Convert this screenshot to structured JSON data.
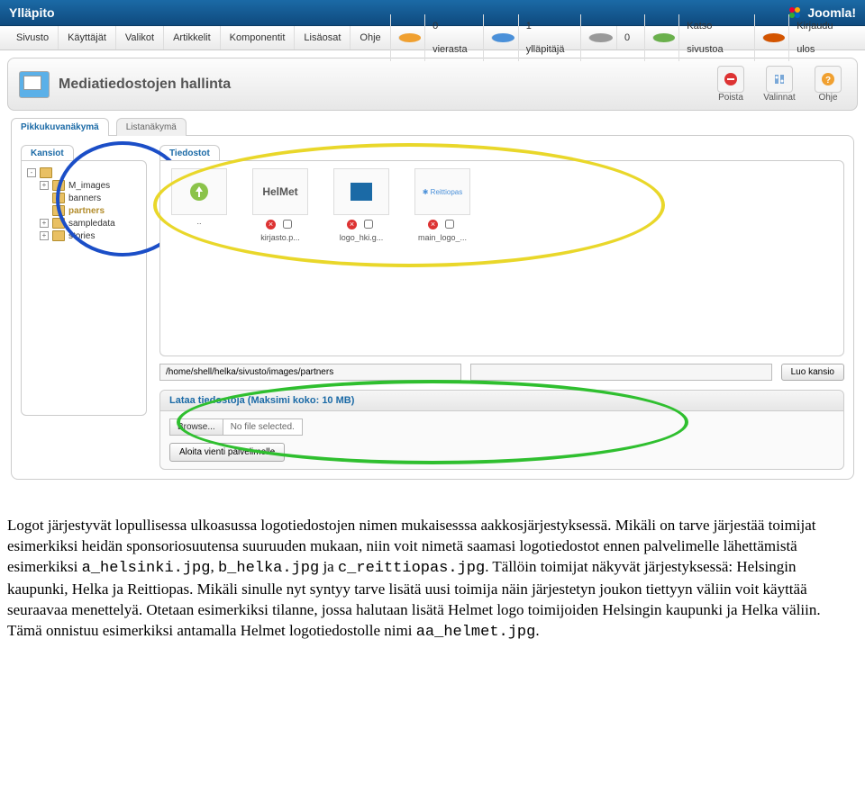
{
  "topbar": {
    "title": "Ylläpito",
    "brand": "Joomla!"
  },
  "menu": {
    "items": [
      "Sivusto",
      "Käyttäjät",
      "Valikot",
      "Artikkelit",
      "Komponentit",
      "Lisäosat",
      "Ohje"
    ]
  },
  "status": {
    "guests": "0 vierasta",
    "admin": "1 ylläpitäjä",
    "msgs": "0",
    "view": "Katso sivustoa",
    "logout": "Kirjaudu ulos"
  },
  "pagehead": {
    "title": "Mediatiedostojen hallinta"
  },
  "toolbar": {
    "delete": "Poista",
    "options": "Valinnat",
    "help": "Ohje"
  },
  "tabs": {
    "thumb": "Pikkukuvanäkymä",
    "list": "Listanäkymä"
  },
  "subtabs": {
    "folders": "Kansiot",
    "files": "Tiedostot"
  },
  "tree": {
    "items": [
      {
        "label": "M_images",
        "expand": "+"
      },
      {
        "label": "banners",
        "expand": ""
      },
      {
        "label": "partners",
        "expand": "",
        "selected": true
      },
      {
        "label": "sampledata",
        "expand": "+"
      },
      {
        "label": "stories",
        "expand": "+"
      }
    ]
  },
  "files": {
    "items": [
      {
        "thumb_type": "up",
        "label": "..",
        "controls": false
      },
      {
        "thumb_type": "helmet",
        "label": "kirjasto.p..."
      },
      {
        "thumb_type": "helsinki",
        "label": "logo_hki.g..."
      },
      {
        "thumb_type": "reittiopas",
        "label": "main_logo_..."
      }
    ]
  },
  "path": {
    "value": "/home/shell/helka/sivusto/images/partners",
    "newfolder_ph": "",
    "create": "Luo kansio"
  },
  "upload": {
    "title": "Lataa tiedostoja (Maksimi koko: 10 MB)",
    "browse": "Browse...",
    "nofile": "No file selected.",
    "start": "Aloita vienti palvelimelle"
  },
  "doc": {
    "p1a": "Logot järjestyvät lopullisessa ulkoasussa logotiedostojen nimen mukaisesssa aakkosjärjestyksessä. Mikäli on tarve järjestää toimijat esimerkiksi heidän sponsoriosuutensa suuruuden mukaan, niin voit nimetä saamasi logotiedostot ennen palvelimelle lähettämistä esimerkiksi ",
    "c1": "a_helsinki.jpg",
    "p1b": ", ",
    "c2": "b_helka.jpg",
    "p1c": " ja ",
    "c3": "c_reittiopas.jpg",
    "p1d": ". Tällöin toimijat näkyvät järjestyksessä: Helsingin kaupunki, Helka ja Reittiopas. Mikäli sinulle nyt syntyy tarve lisätä uusi toimija näin järjestetyn joukon tiettyyn väliin voit käyttää seuraavaa menettelyä. Otetaan esimerkiksi tilanne, jossa halutaan lisätä Helmet logo toimijoiden Helsingin kaupunki ja Helka väliin. Tämä onnistuu esimerkiksi antamalla Helmet logotiedostolle nimi ",
    "c4": "aa_helmet.jpg",
    "p1e": "."
  }
}
